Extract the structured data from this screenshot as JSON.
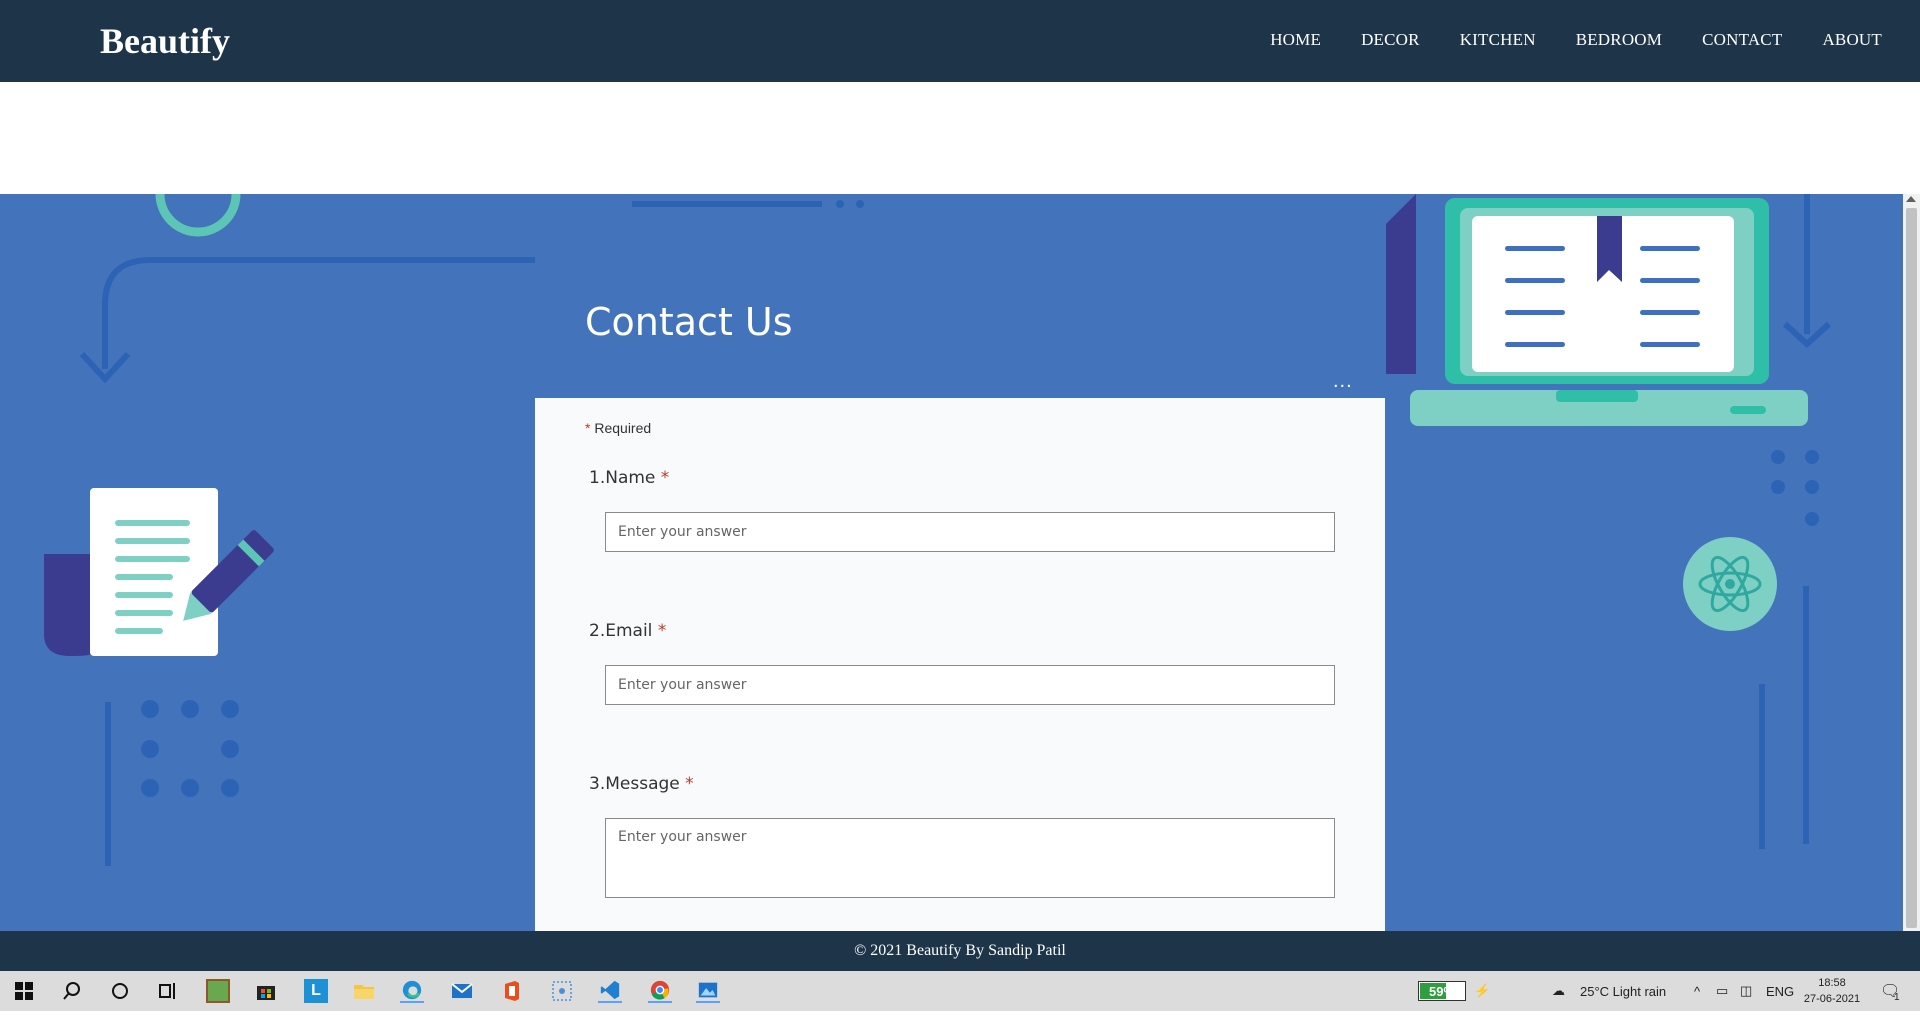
{
  "brand": "Beautify",
  "nav": [
    "HOME",
    "DECOR",
    "KITCHEN",
    "BEDROOM",
    "CONTACT",
    "ABOUT"
  ],
  "contact": {
    "title": "Contact Us",
    "more": "...",
    "required_note": "Required",
    "questions": [
      {
        "number": "1.",
        "label": "Name",
        "placeholder": "Enter your answer"
      },
      {
        "number": "2.",
        "label": "Email",
        "placeholder": "Enter your answer"
      },
      {
        "number": "3.",
        "label": "Message",
        "placeholder": "Enter your answer"
      }
    ]
  },
  "footer": "© 2021 Beautify By Sandip Patil",
  "taskbar": {
    "battery": "59%",
    "battery_level": 0.59,
    "weather": "25°C  Light rain",
    "language": "ENG",
    "time": "18:58",
    "date": "27-06-2021",
    "notification_count": "1",
    "apps": [
      "windows-start-icon",
      "search-icon",
      "cortana-icon",
      "task-view-icon",
      "minecraft-icon",
      "store-icon",
      "l-app-icon",
      "file-explorer-icon",
      "edge-icon",
      "mail-icon",
      "office-icon",
      "snipping-icon",
      "vscode-icon",
      "chrome-icon",
      "photos-icon"
    ]
  },
  "colors": {
    "navbar": "#1e3449",
    "hero": "#4373bb",
    "accent_teal": "#5cc5b5",
    "required": "#c0392b"
  }
}
